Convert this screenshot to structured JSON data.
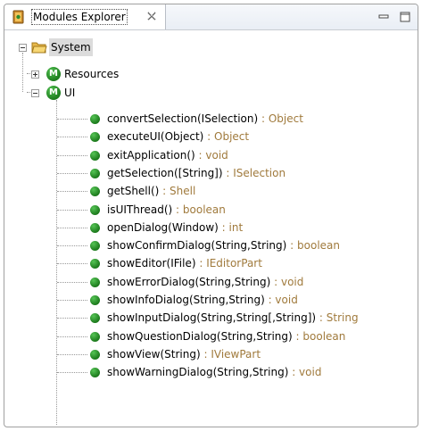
{
  "view": {
    "title": "Modules Explorer",
    "colors": {
      "accent_green": "#2e8b2e",
      "return_type": "#a07a3c",
      "selection": "#dcdcdc"
    }
  },
  "tree": {
    "root": {
      "label": "System",
      "icon": "folder-open-icon",
      "expanded": true,
      "selected": true
    },
    "modules": [
      {
        "label": "Resources",
        "icon": "module-icon",
        "expanded": false
      },
      {
        "label": "UI",
        "icon": "module-icon",
        "expanded": true
      }
    ],
    "methods": [
      {
        "sig": "convertSelection(ISelection)",
        "ret": " : Object"
      },
      {
        "sig": "executeUI(Object)",
        "ret": " : Object"
      },
      {
        "sig": "exitApplication()",
        "ret": " : void"
      },
      {
        "sig": "getSelection([String])",
        "ret": " : ISelection"
      },
      {
        "sig": "getShell()",
        "ret": " : Shell"
      },
      {
        "sig": "isUIThread()",
        "ret": " : boolean"
      },
      {
        "sig": "openDialog(Window)",
        "ret": " : int"
      },
      {
        "sig": "showConfirmDialog(String,String)",
        "ret": " : boolean"
      },
      {
        "sig": "showEditor(IFile)",
        "ret": " : IEditorPart"
      },
      {
        "sig": "showErrorDialog(String,String)",
        "ret": " : void"
      },
      {
        "sig": "showInfoDialog(String,String)",
        "ret": " : void"
      },
      {
        "sig": "showInputDialog(String,String[,String])",
        "ret": " : String"
      },
      {
        "sig": "showQuestionDialog(String,String)",
        "ret": " : boolean"
      },
      {
        "sig": "showView(String)",
        "ret": " : IViewPart"
      },
      {
        "sig": "showWarningDialog(String,String)",
        "ret": " : void"
      }
    ]
  }
}
